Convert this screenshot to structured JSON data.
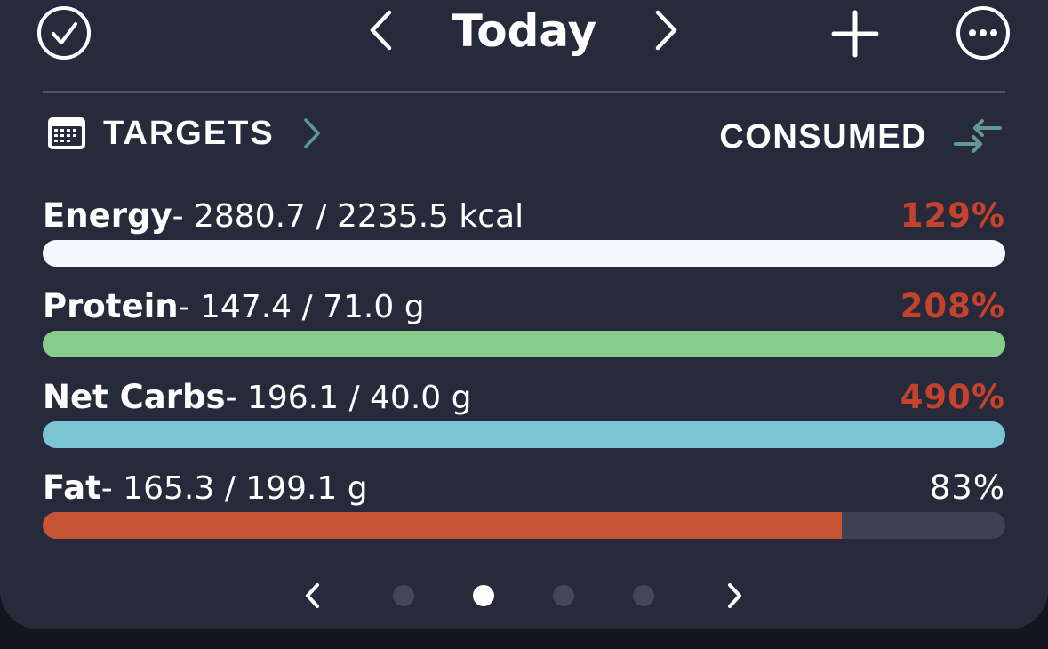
{
  "header": {
    "title": "Today",
    "check_icon": "check-circle-icon",
    "prev_icon": "chevron-left-icon",
    "next_icon": "chevron-right-icon",
    "add_icon": "plus-icon",
    "more_icon": "more-horizontal-icon"
  },
  "summary": {
    "targets_label": "TARGETS",
    "consumed_label": "CONSUMED",
    "calendar_icon": "calendar-icon",
    "swap_icon": "swap-arrows-icon"
  },
  "nutrients": [
    {
      "name": "Energy",
      "values": "- 2880.7 / 2235.5 kcal",
      "percent_label": "129%",
      "percent": 129,
      "over": true,
      "color": "#f5f6fc"
    },
    {
      "name": "Protein",
      "values": "- 147.4 / 71.0 g",
      "percent_label": "208%",
      "percent": 208,
      "over": true,
      "color": "#86cc8a"
    },
    {
      "name": "Net Carbs",
      "values": "- 196.1 / 40.0 g",
      "percent_label": "490%",
      "percent": 490,
      "over": true,
      "color": "#7bc4d4"
    },
    {
      "name": "Fat",
      "values": "- 165.3 / 199.1 g",
      "percent_label": "83%",
      "percent": 83,
      "over": false,
      "color": "#c75434"
    }
  ],
  "colors": {
    "over_target": "#c5422c",
    "accent_teal": "#5f9a92",
    "card_bg": "#272a3a"
  },
  "pager": {
    "page_count": 4,
    "active_page": 2
  }
}
